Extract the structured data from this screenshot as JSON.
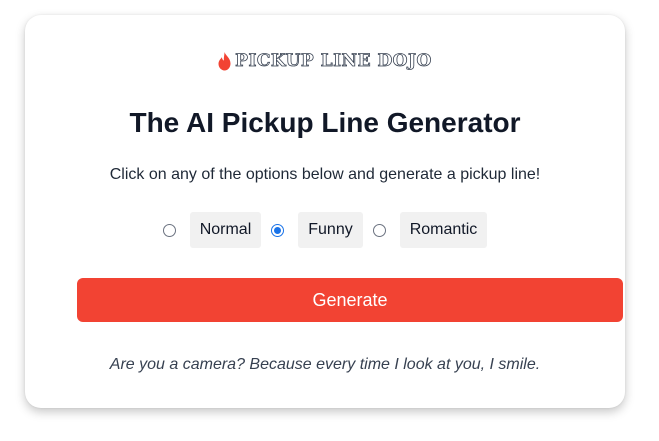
{
  "brand": {
    "logo_text": "PICKUP LINE DOJO",
    "icon": "flame-icon",
    "icon_color": "#f24333"
  },
  "heading": {
    "title": "The AI Pickup Line Generator",
    "subtitle": "Click on any of the options below and generate a pickup line!"
  },
  "options": {
    "items": [
      {
        "label": "Normal",
        "checked": false
      },
      {
        "label": "Funny",
        "checked": true
      },
      {
        "label": "Romantic",
        "checked": false
      }
    ],
    "selected": "Funny"
  },
  "actions": {
    "generate_label": "Generate",
    "button_color": "#f24333"
  },
  "result": {
    "pickup_line": "Are you a camera? Because every time I look at you, I smile."
  }
}
